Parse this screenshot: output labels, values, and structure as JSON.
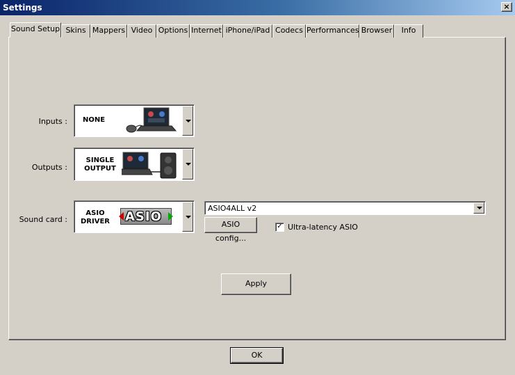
{
  "window": {
    "title": "Settings",
    "close_glyph": "×"
  },
  "tabs": [
    {
      "label": "Sound Setup",
      "active": true
    },
    {
      "label": "Skins"
    },
    {
      "label": "Mappers"
    },
    {
      "label": "Video"
    },
    {
      "label": "Options"
    },
    {
      "label": "Internet"
    },
    {
      "label": "iPhone/iPad"
    },
    {
      "label": "Codecs"
    },
    {
      "label": "Performances"
    },
    {
      "label": "Browser"
    },
    {
      "label": "Info"
    }
  ],
  "sound_setup": {
    "inputs": {
      "label": "Inputs :",
      "value": "NONE"
    },
    "outputs": {
      "label": "Outputs :",
      "value_line1": "SINGLE",
      "value_line2": "OUTPUT"
    },
    "sound_card": {
      "label": "Sound card :",
      "value_line1": "ASIO",
      "value_line2": "DRIVER",
      "logo_text": "ASIO",
      "device_select": "ASIO4ALL v2",
      "config_button": "ASIO config...",
      "ultra_latency_label": "Ultra-latency ASIO",
      "ultra_latency_checked": "✓"
    },
    "apply_button": "Apply"
  },
  "footer": {
    "ok_button": "OK"
  }
}
